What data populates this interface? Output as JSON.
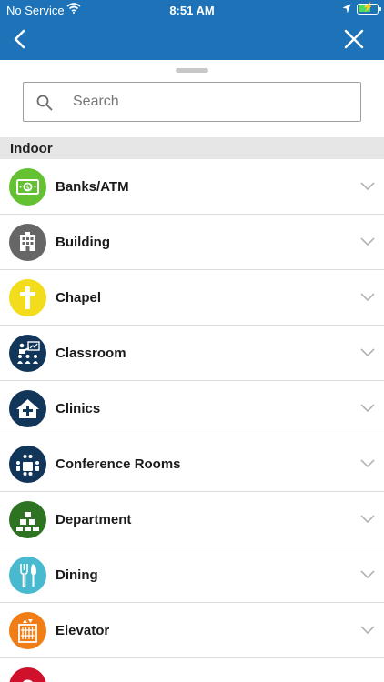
{
  "status_bar": {
    "carrier": "No Service",
    "time": "8:51 AM"
  },
  "header": {
    "back_icon": "chevron-left-icon",
    "close_icon": "close-icon"
  },
  "search": {
    "placeholder": "Search",
    "value": ""
  },
  "section": {
    "title": "Indoor"
  },
  "categories": [
    {
      "label": "Banks/ATM",
      "icon": "money-icon",
      "color": "#63c132"
    },
    {
      "label": "Building",
      "icon": "building-icon",
      "color": "#666666"
    },
    {
      "label": "Chapel",
      "icon": "cross-icon",
      "color": "#f2dc1b"
    },
    {
      "label": "Classroom",
      "icon": "classroom-icon",
      "color": "#11365a"
    },
    {
      "label": "Clinics",
      "icon": "clinic-icon",
      "color": "#11365a"
    },
    {
      "label": "Conference Rooms",
      "icon": "conference-icon",
      "color": "#11365a"
    },
    {
      "label": "Department",
      "icon": "department-icon",
      "color": "#2e7321"
    },
    {
      "label": "Dining",
      "icon": "dining-icon",
      "color": "#49b9cf"
    },
    {
      "label": "Elevator",
      "icon": "elevator-icon",
      "color": "#f07d16"
    },
    {
      "label": "",
      "icon": "medical-icon",
      "color": "#d0112b"
    }
  ]
}
